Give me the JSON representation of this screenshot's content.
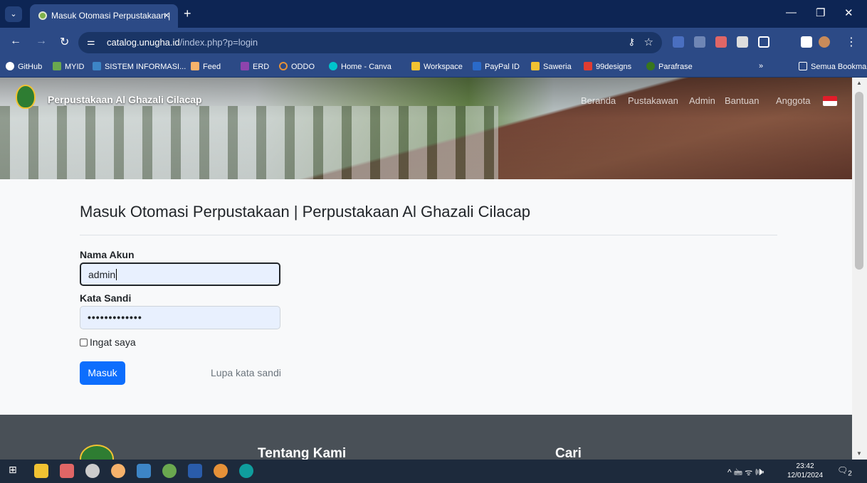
{
  "browser": {
    "tab_title": "Masuk Otomasi Perpustakaan | ",
    "tab_close": "×",
    "new_tab": "+",
    "url_host": "catalog.unugha.id",
    "url_path": "/index.php?p=login",
    "minimize": "—",
    "restore": "❐",
    "close": "✕"
  },
  "bookmarks": [
    {
      "label": "GitHub",
      "color": "#ffffff"
    },
    {
      "label": "MYID",
      "color": "#6aa84f"
    },
    {
      "label": "SISTEM INFORMASI...",
      "color": "#3d85c6"
    },
    {
      "label": "Feed",
      "color": "#f6b26b"
    },
    {
      "label": "ERD",
      "color": "#8e44ad"
    },
    {
      "label": "ODDO",
      "color": "#e69138"
    },
    {
      "label": "Home - Canva",
      "color": "#00c4cc"
    },
    {
      "label": "Workspace",
      "color": "#f1c232"
    },
    {
      "label": "PayPal ID",
      "color": "#2a6ac9"
    },
    {
      "label": "Saweria",
      "color": "#f1c232"
    },
    {
      "label": "99designs",
      "color": "#e03c31"
    },
    {
      "label": "Parafrase",
      "color": "#38761d"
    }
  ],
  "bookmarks_more": "»",
  "bookmarks_folder": "Semua Bookmark",
  "site": {
    "brand": "Perpustakaan Al Ghazali Cilacap",
    "nav": [
      "Beranda",
      "Pustakawan",
      "Admin",
      "Bantuan",
      "Anggota"
    ]
  },
  "login": {
    "heading": "Masuk Otomasi Perpustakaan | Perpustakaan Al Ghazali Cilacap",
    "username_label": "Nama Akun",
    "username_value": "admin",
    "password_label": "Kata Sandi",
    "password_value": "•••••••••••••",
    "remember_label": "Ingat saya",
    "submit_label": "Masuk",
    "forgot_label": "Lupa kata sandi"
  },
  "footer": {
    "about": "Tentang Kami",
    "search": "Cari"
  },
  "taskbar": {
    "time": "23:42",
    "date": "12/01/2024",
    "tray": "^ 🖮 ᯤ 🕪",
    "notif": "2"
  }
}
